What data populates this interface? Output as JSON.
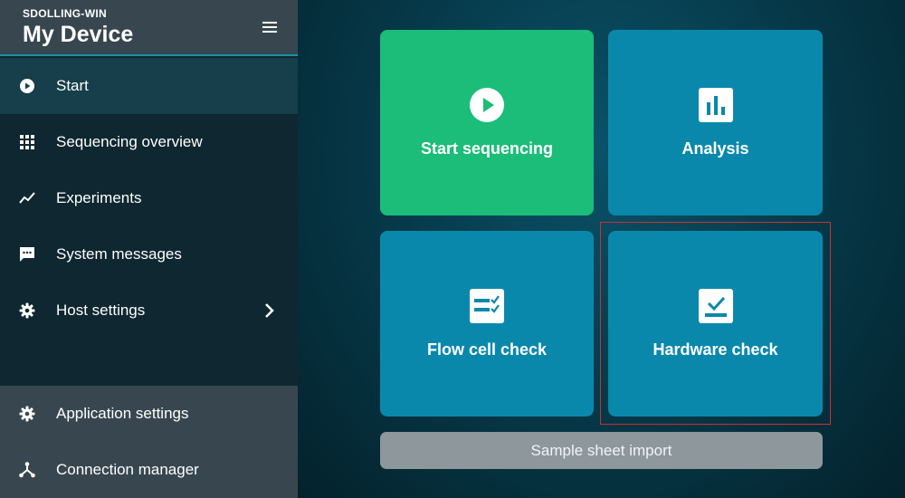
{
  "header": {
    "device_name": "SDOLLING-WIN",
    "title": "My Device"
  },
  "nav": {
    "items": [
      {
        "label": "Start",
        "icon": "play-circle-icon"
      },
      {
        "label": "Sequencing overview",
        "icon": "grid-icon"
      },
      {
        "label": "Experiments",
        "icon": "trend-icon"
      },
      {
        "label": "System messages",
        "icon": "message-icon"
      },
      {
        "label": "Host settings",
        "icon": "gear-icon"
      }
    ],
    "active": "Start"
  },
  "bottom_nav": {
    "items": [
      {
        "label": "Application settings",
        "icon": "gear-icon"
      },
      {
        "label": "Connection manager",
        "icon": "network-icon"
      }
    ]
  },
  "tiles": [
    {
      "label": "Start sequencing",
      "icon": "play-circle-icon",
      "color": "#1bbd78"
    },
    {
      "label": "Analysis",
      "icon": "bar-chart-icon",
      "color": "#0a88ac"
    },
    {
      "label": "Flow cell check",
      "icon": "checklist-icon",
      "color": "#0a88ac"
    },
    {
      "label": "Hardware check",
      "icon": "hardware-check-icon",
      "color": "#0a88ac"
    }
  ],
  "sample_sheet_button": "Sample sheet import",
  "colors": {
    "sidebar": "#0e2730",
    "header": "#38474f",
    "accent": "#1890a8",
    "tile_blue": "#0a88ac",
    "tile_green": "#1bbd78",
    "button_gray": "#8e979b",
    "highlight": "#c83232"
  }
}
